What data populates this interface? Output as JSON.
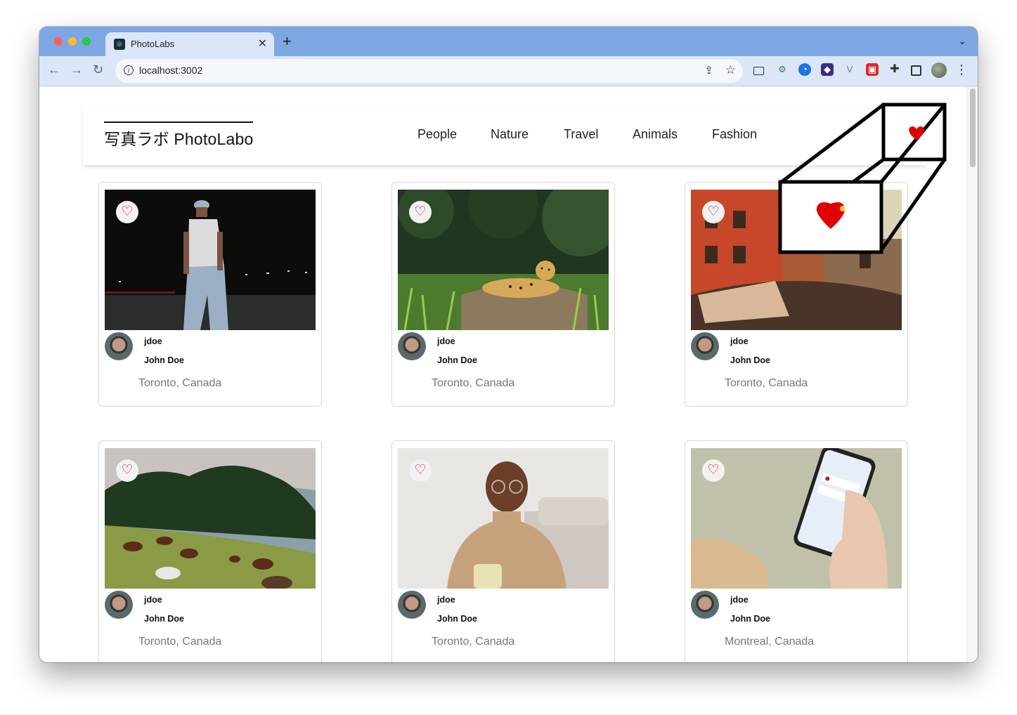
{
  "browser": {
    "tab_title": "PhotoLabs",
    "tab_close": "✕",
    "new_tab": "+",
    "url": "localhost:3002"
  },
  "app": {
    "logo": "写真ラボ PhotoLabo",
    "topics": [
      "People",
      "Nature",
      "Travel",
      "Animals",
      "Fashion"
    ]
  },
  "photos": [
    {
      "username": "jdoe",
      "name": "John Doe",
      "location": "Toronto, Canada",
      "favourited": false,
      "subject": "man-walking-night-icon"
    },
    {
      "username": "jdoe",
      "name": "John Doe",
      "location": "Toronto, Canada",
      "favourited": false,
      "subject": "jaguar-icon"
    },
    {
      "username": "jdoe",
      "name": "John Doe",
      "location": "Toronto, Canada",
      "favourited": false,
      "subject": "city-street-icon"
    },
    {
      "username": "jdoe",
      "name": "John Doe",
      "location": "Toronto, Canada",
      "favourited": false,
      "subject": "horses-field-icon"
    },
    {
      "username": "jdoe",
      "name": "John Doe",
      "location": "Toronto, Canada",
      "favourited": false,
      "subject": "smiling-man-icon"
    },
    {
      "username": "jdoe",
      "name": "John Doe",
      "location": "Montreal, Canada",
      "favourited": false,
      "subject": "phone-hand-icon"
    }
  ],
  "colors": {
    "heart": "#c4102e",
    "tab_strip": "#7da7e3",
    "toolbar": "#dbe7f8"
  }
}
